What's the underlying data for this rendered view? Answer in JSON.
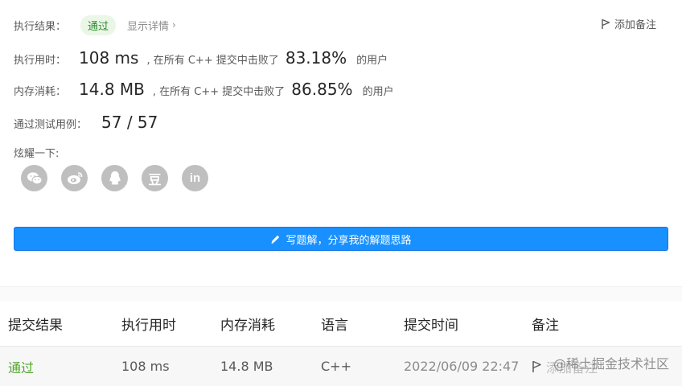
{
  "result": {
    "label": "执行结果：",
    "status": "通过",
    "details_link": "显示详情",
    "details_chevron": "›",
    "add_note": "添加备注"
  },
  "runtime": {
    "label": "执行用时：",
    "value": "108 ms",
    "middle": ", 在所有 C++ 提交中击败了",
    "percent": "83.18%",
    "suffix": "的用户"
  },
  "memory": {
    "label": "内存消耗：",
    "value": "14.8 MB",
    "middle": ", 在所有 C++ 提交中击败了",
    "percent": "86.85%",
    "suffix": "的用户"
  },
  "testcases": {
    "label": "通过测试用例：",
    "value": "57 / 57"
  },
  "share": {
    "label": "炫耀一下:",
    "icons": [
      "wechat-icon",
      "weibo-icon",
      "qq-icon",
      "douban-icon",
      "linkedin-icon"
    ],
    "douban_glyph": "豆",
    "linkedin_glyph": "in"
  },
  "write_solution": {
    "label": "写题解，分享我的解题思路"
  },
  "table": {
    "headers": [
      "提交结果",
      "执行用时",
      "内存消耗",
      "语言",
      "提交时间",
      "备注"
    ],
    "rows": [
      {
        "status": "通过",
        "runtime": "108 ms",
        "memory": "14.8 MB",
        "language": "C++",
        "time": "2022/06/09 22:47",
        "note": "添加备注"
      }
    ]
  },
  "watermark": "@稀土掘金技术社区",
  "colors": {
    "accent": "#1890ff",
    "success": "#52a62e",
    "share_icon": "#bfbfbf"
  }
}
